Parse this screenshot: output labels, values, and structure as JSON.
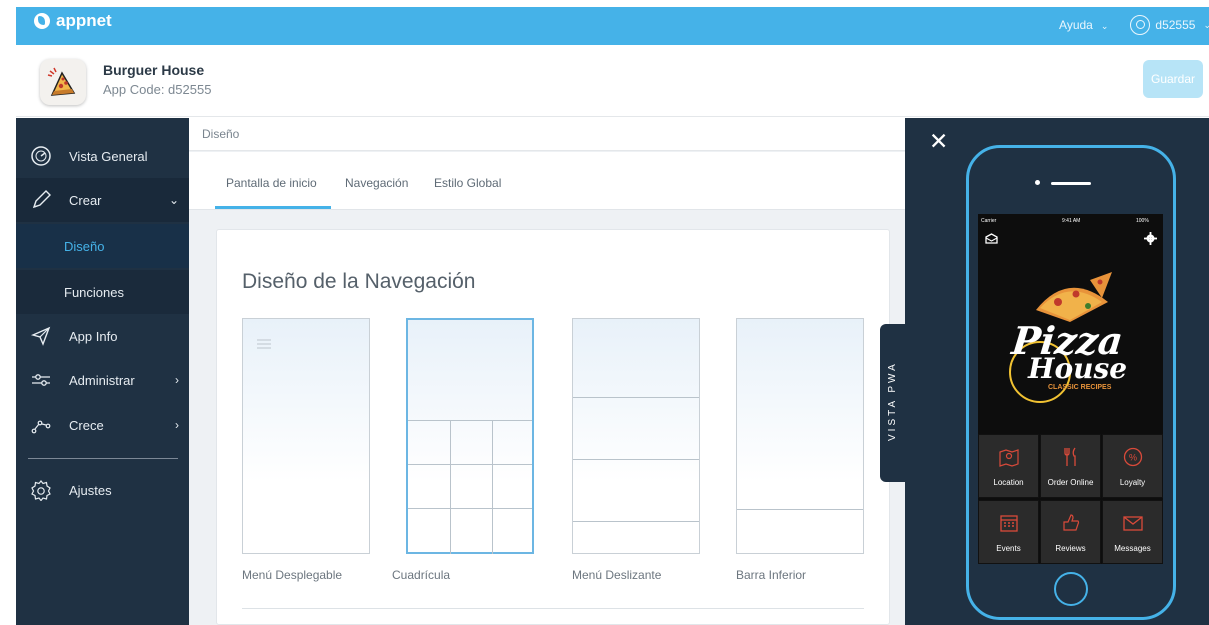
{
  "topbar": {
    "brand": "appnet",
    "help_label": "Ayuda",
    "user_label": "d52555"
  },
  "app": {
    "name": "Burguer House",
    "code": "App Code: d52555",
    "save_label": "Guardar"
  },
  "sidebar": {
    "items": [
      {
        "label": "Vista General",
        "icon": "gauge-icon"
      },
      {
        "label": "Crear",
        "icon": "pencil-icon"
      },
      {
        "label": "Diseño"
      },
      {
        "label": "Funciones"
      },
      {
        "label": "App Info",
        "icon": "send-icon"
      },
      {
        "label": "Administrar",
        "icon": "sliders-icon"
      },
      {
        "label": "Crece",
        "icon": "growth-icon"
      },
      {
        "label": "Ajustes",
        "icon": "gear-icon"
      }
    ]
  },
  "main": {
    "breadcrumb": "Diseño",
    "tabs": [
      {
        "label": "Pantalla de inicio",
        "active": true
      },
      {
        "label": "Navegación"
      },
      {
        "label": "Estilo Global"
      }
    ],
    "section_title": "Diseño de la Navegación",
    "options": [
      {
        "label": "Menú Desplegable"
      },
      {
        "label": "Cuadrícula",
        "selected": true
      },
      {
        "label": "Menú Deslizante"
      },
      {
        "label": "Barra Inferior"
      }
    ]
  },
  "preview": {
    "pwa_label": "VISTA PWA",
    "status": {
      "carrier": "Carrier",
      "time": "9:41 AM",
      "battery": "100%"
    },
    "logo": {
      "line1": "Pizza",
      "line2": "House",
      "tagline": "CLASSIC RECIPES"
    },
    "grid": [
      {
        "label": "Location",
        "icon": "map-icon"
      },
      {
        "label": "Order Online",
        "icon": "cutlery-icon"
      },
      {
        "label": "Loyalty",
        "icon": "percent-icon"
      },
      {
        "label": "Events",
        "icon": "calendar-icon"
      },
      {
        "label": "Reviews",
        "icon": "thumbs-up-icon"
      },
      {
        "label": "Messages",
        "icon": "envelope-icon"
      }
    ],
    "accent": "#45b2e8",
    "cell_icon_color": "#d94a3a"
  }
}
